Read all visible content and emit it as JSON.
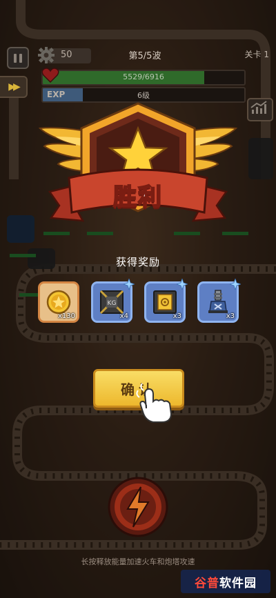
{
  "hud": {
    "gear_count": "50",
    "wave_text": "第5/5波",
    "level_text": "关卡 1",
    "hp": {
      "text": "5529/6916",
      "fraction": 0.8
    },
    "exp": {
      "label": "EXP",
      "text": "6级",
      "fraction": 0.2
    }
  },
  "victory": {
    "title": "胜利",
    "rewards_title": "获得奖励",
    "rewards": [
      {
        "icon": "gold-coin-icon",
        "qty": "x130",
        "frame": "gold"
      },
      {
        "icon": "weight-crate-icon",
        "qty": "x4",
        "frame": "blue",
        "crate_text": "KG"
      },
      {
        "icon": "gear-crate-icon",
        "qty": "x3",
        "frame": "blue"
      },
      {
        "icon": "turret-icon",
        "qty": "x3",
        "frame": "blue"
      }
    ],
    "confirm_label": "确认"
  },
  "footer": {
    "hint": "长按释放能量加速火车和炮塔攻速"
  },
  "watermark": {
    "part1": "谷普",
    "part2": "软件园"
  },
  "colors": {
    "button_yellow": "#f5cc45",
    "ribbon_red": "#c9452d",
    "badge_gold": "#f2b733",
    "reward_blue": "#5e7fc4",
    "hp_green": "#2f6a2a"
  }
}
